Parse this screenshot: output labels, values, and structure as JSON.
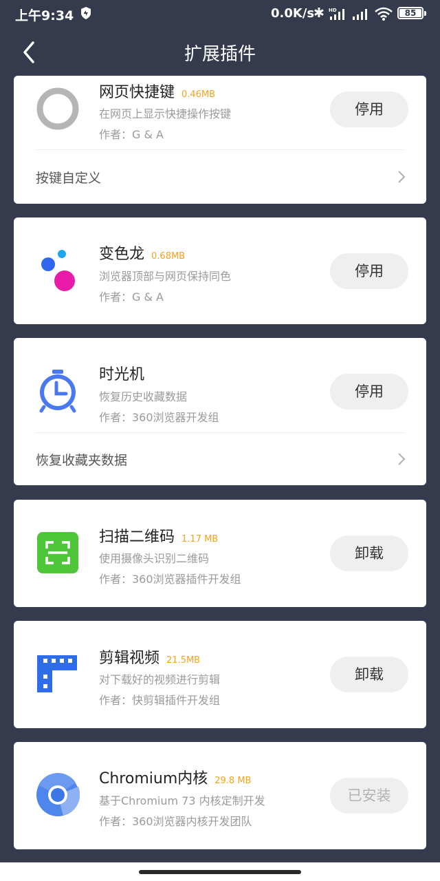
{
  "status_bar": {
    "time": "上午9:34",
    "network_speed": "0.0K/s",
    "battery": "85",
    "icons": [
      "shield-icon",
      "bluetooth-icon",
      "signal-hd-icon",
      "signal-icon",
      "wifi-icon",
      "battery-icon"
    ]
  },
  "nav": {
    "title": "扩展插件",
    "back_icon": "chevron-left-icon"
  },
  "plugins": [
    {
      "name": "网页快捷键",
      "size": "0.46MB",
      "desc": "在网页上显示快捷操作按键",
      "author": "作者：G & A",
      "button": "停用",
      "sub_label": "按键自定义",
      "icon": "ring-icon"
    },
    {
      "name": "变色龙",
      "size": "0.68MB",
      "desc": "浏览器顶部与网页保持同色",
      "author": "作者：G & A",
      "button": "停用",
      "icon": "dots-icon"
    },
    {
      "name": "时光机",
      "size": "",
      "desc": "恢复历史收藏数据",
      "author": "作者：360浏览器开发组",
      "button": "停用",
      "sub_label": "恢复收藏夹数据",
      "icon": "alarm-clock-icon"
    },
    {
      "name": "扫描二维码",
      "size": "1.17 MB",
      "desc": "使用摄像头识别二维码",
      "author": "作者：360浏览器插件开发组",
      "button": "卸载",
      "icon": "qr-scan-icon"
    },
    {
      "name": "剪辑视频",
      "size": "21.5MB",
      "desc": "对下载好的视频进行剪辑",
      "author": "作者：快剪辑插件开发组",
      "button": "卸载",
      "icon": "film-strip-icon"
    },
    {
      "name": "Chromium内核",
      "size": "29.8 MB",
      "desc": "基于Chromium 73 内核定制开发",
      "author": "作者：360浏览器内核开发团队",
      "button": "已安装",
      "icon": "chromium-icon"
    }
  ],
  "colors": {
    "background": "#353a4c",
    "size_accent": "#f2a31b",
    "button_bg": "#efefef"
  }
}
